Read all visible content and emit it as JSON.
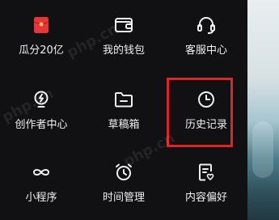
{
  "grid": {
    "items": [
      {
        "label": "瓜分20亿",
        "icon": "red-envelope-icon"
      },
      {
        "label": "我的钱包",
        "icon": "wallet-icon"
      },
      {
        "label": "客服中心",
        "icon": "headset-icon"
      },
      {
        "label": "创作者中心",
        "icon": "lightbulb-icon"
      },
      {
        "label": "草稿箱",
        "icon": "folder-icon"
      },
      {
        "label": "历史记录",
        "icon": "clock-icon"
      },
      {
        "label": "小程序",
        "icon": "infinity-icon"
      },
      {
        "label": "时间管理",
        "icon": "alarm-clock-icon"
      },
      {
        "label": "内容偏好",
        "icon": "document-heart-icon"
      }
    ]
  },
  "watermark": {
    "text": "php.cn"
  },
  "colors": {
    "background": "#111114",
    "highlight": "#e02424",
    "envelope": "#e8353a"
  }
}
